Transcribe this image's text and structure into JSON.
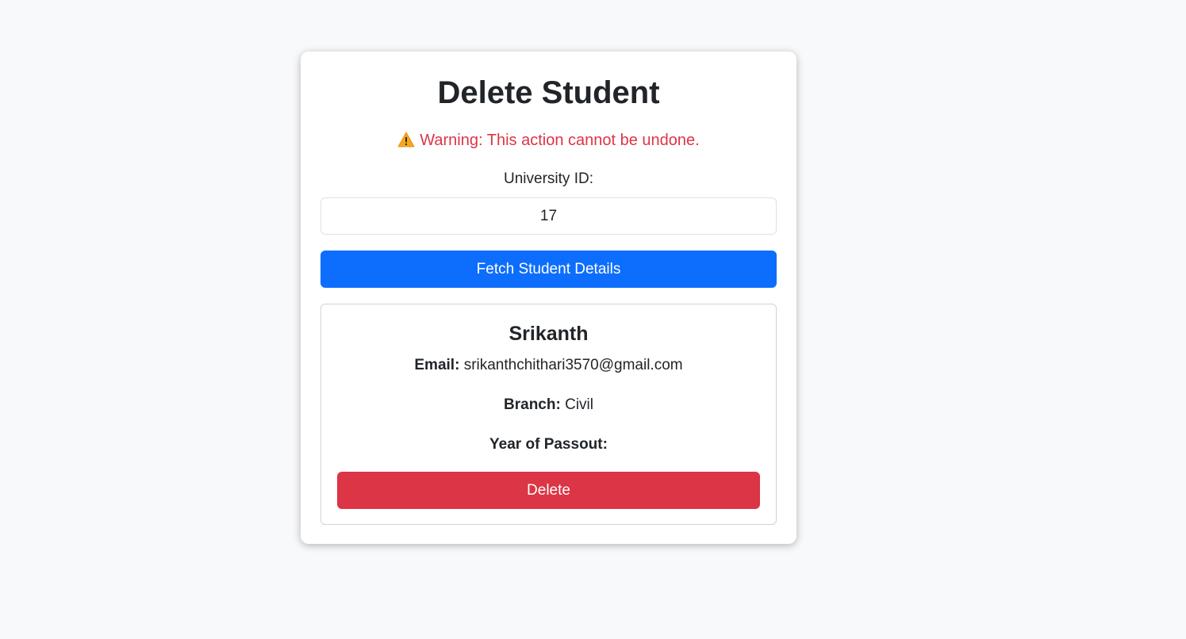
{
  "page": {
    "title": "Delete Student",
    "warning": {
      "icon": "warning-icon",
      "text": "Warning: This action cannot be undone.",
      "color": "#dc3545"
    },
    "university_id_label": "University ID:",
    "university_id_value": "17",
    "fetch_button_label": "Fetch Student Details",
    "accent_color": "#0d6efd"
  },
  "student": {
    "name": "Srikanth",
    "email_label": "Email:",
    "email": "srikanthchithari3570@gmail.com",
    "branch_label": "Branch:",
    "branch": "Civil",
    "year_label": "Year of Passout:",
    "year": "",
    "delete_button_label": "Delete",
    "delete_color": "#dc3545"
  }
}
